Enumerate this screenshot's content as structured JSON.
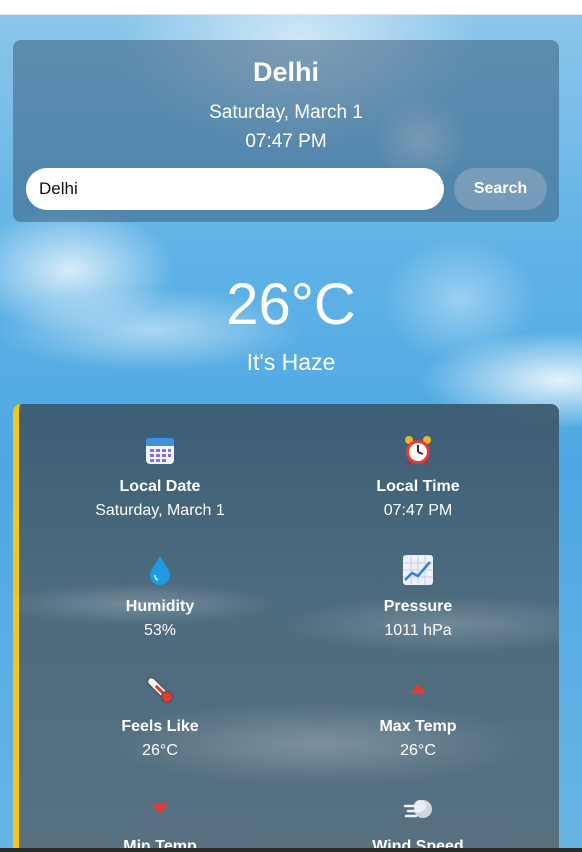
{
  "header": {
    "city": "Delhi",
    "date": "Saturday, March 1",
    "time": "07:47 PM"
  },
  "search": {
    "value": "Delhi",
    "button_label": "Search"
  },
  "current": {
    "temperature": "26°C",
    "condition": "It's Haze"
  },
  "details": [
    {
      "label": "Local Date",
      "value": "Saturday, March 1",
      "icon": "calendar-icon"
    },
    {
      "label": "Local Time",
      "value": "07:47 PM",
      "icon": "alarm-clock-icon"
    },
    {
      "label": "Humidity",
      "value": "53%",
      "icon": "droplet-icon"
    },
    {
      "label": "Pressure",
      "value": "1011 hPa",
      "icon": "chart-increasing-icon"
    },
    {
      "label": "Feels Like",
      "value": "26°C",
      "icon": "thermometer-icon"
    },
    {
      "label": "Max Temp",
      "value": "26°C",
      "icon": "up-triangle-icon"
    },
    {
      "label": "Min Temp",
      "value": "",
      "icon": "down-triangle-icon"
    },
    {
      "label": "Wind Speed",
      "value": "",
      "icon": "wind-icon"
    }
  ],
  "colors": {
    "accent_border": "#f5c518",
    "triangle_red": "#e53935"
  }
}
